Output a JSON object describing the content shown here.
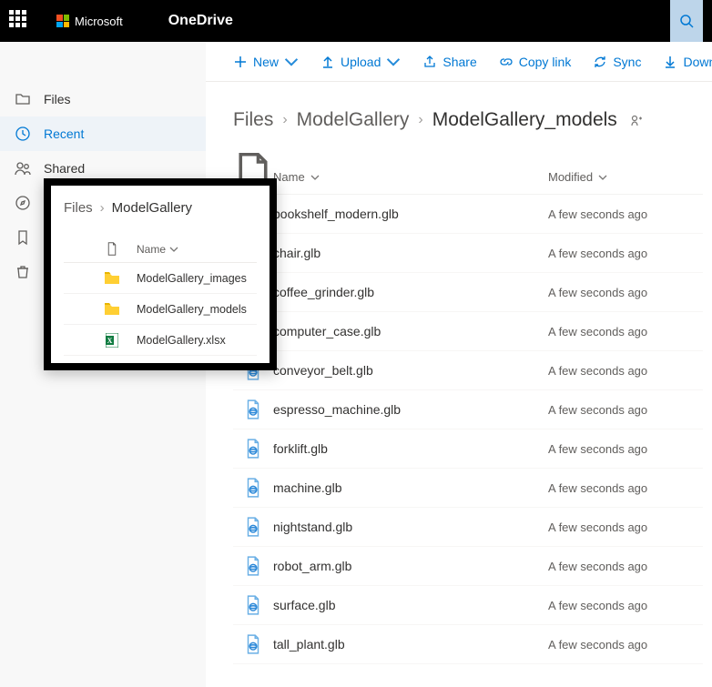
{
  "header": {
    "microsoft": "Microsoft",
    "app_name": "OneDrive"
  },
  "commands": {
    "new": "New",
    "upload": "Upload",
    "share": "Share",
    "copy_link": "Copy link",
    "sync": "Sync",
    "download": "Download"
  },
  "rail": {
    "files": "Files",
    "recent": "Recent",
    "shared": "Shared"
  },
  "breadcrumb": {
    "root": "Files",
    "mid": "ModelGallery",
    "current": "ModelGallery_models"
  },
  "columns": {
    "name": "Name",
    "modified": "Modified"
  },
  "files": [
    {
      "name": "bookshelf_modern.glb",
      "modified": "A few seconds ago"
    },
    {
      "name": "chair.glb",
      "modified": "A few seconds ago"
    },
    {
      "name": "coffee_grinder.glb",
      "modified": "A few seconds ago"
    },
    {
      "name": "computer_case.glb",
      "modified": "A few seconds ago"
    },
    {
      "name": "conveyor_belt.glb",
      "modified": "A few seconds ago"
    },
    {
      "name": "espresso_machine.glb",
      "modified": "A few seconds ago"
    },
    {
      "name": "forklift.glb",
      "modified": "A few seconds ago"
    },
    {
      "name": "machine.glb",
      "modified": "A few seconds ago"
    },
    {
      "name": "nightstand.glb",
      "modified": "A few seconds ago"
    },
    {
      "name": "robot_arm.glb",
      "modified": "A few seconds ago"
    },
    {
      "name": "surface.glb",
      "modified": "A few seconds ago"
    },
    {
      "name": "tall_plant.glb",
      "modified": "A few seconds ago"
    }
  ],
  "overlay": {
    "breadcrumb": {
      "root": "Files",
      "current": "ModelGallery"
    },
    "name_header": "Name",
    "items": [
      {
        "name": "ModelGallery_images",
        "kind": "folder"
      },
      {
        "name": "ModelGallery_models",
        "kind": "folder"
      },
      {
        "name": "ModelGallery.xlsx",
        "kind": "xlsx"
      }
    ]
  }
}
